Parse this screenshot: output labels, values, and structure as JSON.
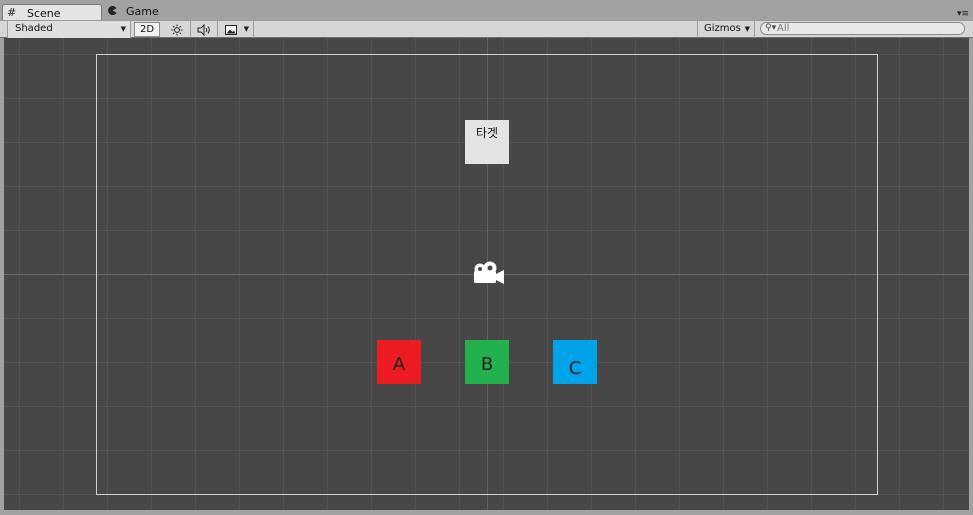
{
  "tabs": [
    {
      "label": "Scene",
      "icon": "grid-icon",
      "active": true
    },
    {
      "label": "Game",
      "icon": "pacman-icon",
      "active": false
    }
  ],
  "panel_menu": "▾≡",
  "toolbar": {
    "shading_mode": "Shaded",
    "mode_2d_label": "2D",
    "lighting_icon": "sun-icon",
    "audio_icon": "speaker-icon",
    "effects_icon": "image-icon",
    "gizmos_label": "Gizmos",
    "search_placeholder": "All"
  },
  "scene": {
    "target_label": "타겟",
    "buttons": [
      {
        "label": "A",
        "color": "#ed1c24"
      },
      {
        "label": "B",
        "color": "#22b14c"
      },
      {
        "label": "C",
        "color": "#00a2e8"
      }
    ],
    "target_color": "#e3e3e3",
    "background_color": "#474747"
  }
}
